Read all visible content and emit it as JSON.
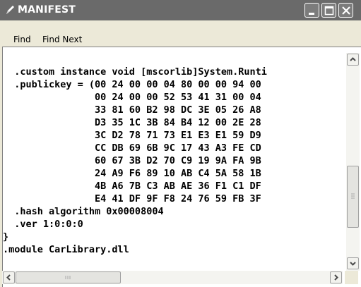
{
  "window": {
    "title": "MANIFEST"
  },
  "menu": {
    "items": [
      "Find",
      "Find Next"
    ]
  },
  "code_lines": [
    "  .custom instance void [mscorlib]System.Runti",
    "  .publickey = (00 24 00 00 04 80 00 00 94 00",
    "                00 24 00 00 52 53 41 31 00 04",
    "                33 81 60 B2 98 DC 3E 05 26 A8",
    "                D3 35 1C 3B 84 B4 12 00 2E 28",
    "                3C D2 78 71 73 E1 E3 E1 59 D9",
    "                CC DB 69 6B 9C 17 43 A3 FE CD",
    "                60 67 3B D2 70 C9 19 9A FA 9B",
    "                24 A9 F6 89 10 AB C4 5A 58 1B",
    "                4B A6 7B C3 AB AE 36 F1 C1 DF",
    "                E4 41 DF 9F F8 24 76 59 FB 3F",
    "  .hash algorithm 0x00008004",
    "  .ver 1:0:0:0",
    "}",
    ".module CarLibrary.dll"
  ],
  "colors": {
    "titlebar": "#6a6a6a",
    "editor_bg": "#ffffff",
    "chrome": "#ece9d8"
  }
}
